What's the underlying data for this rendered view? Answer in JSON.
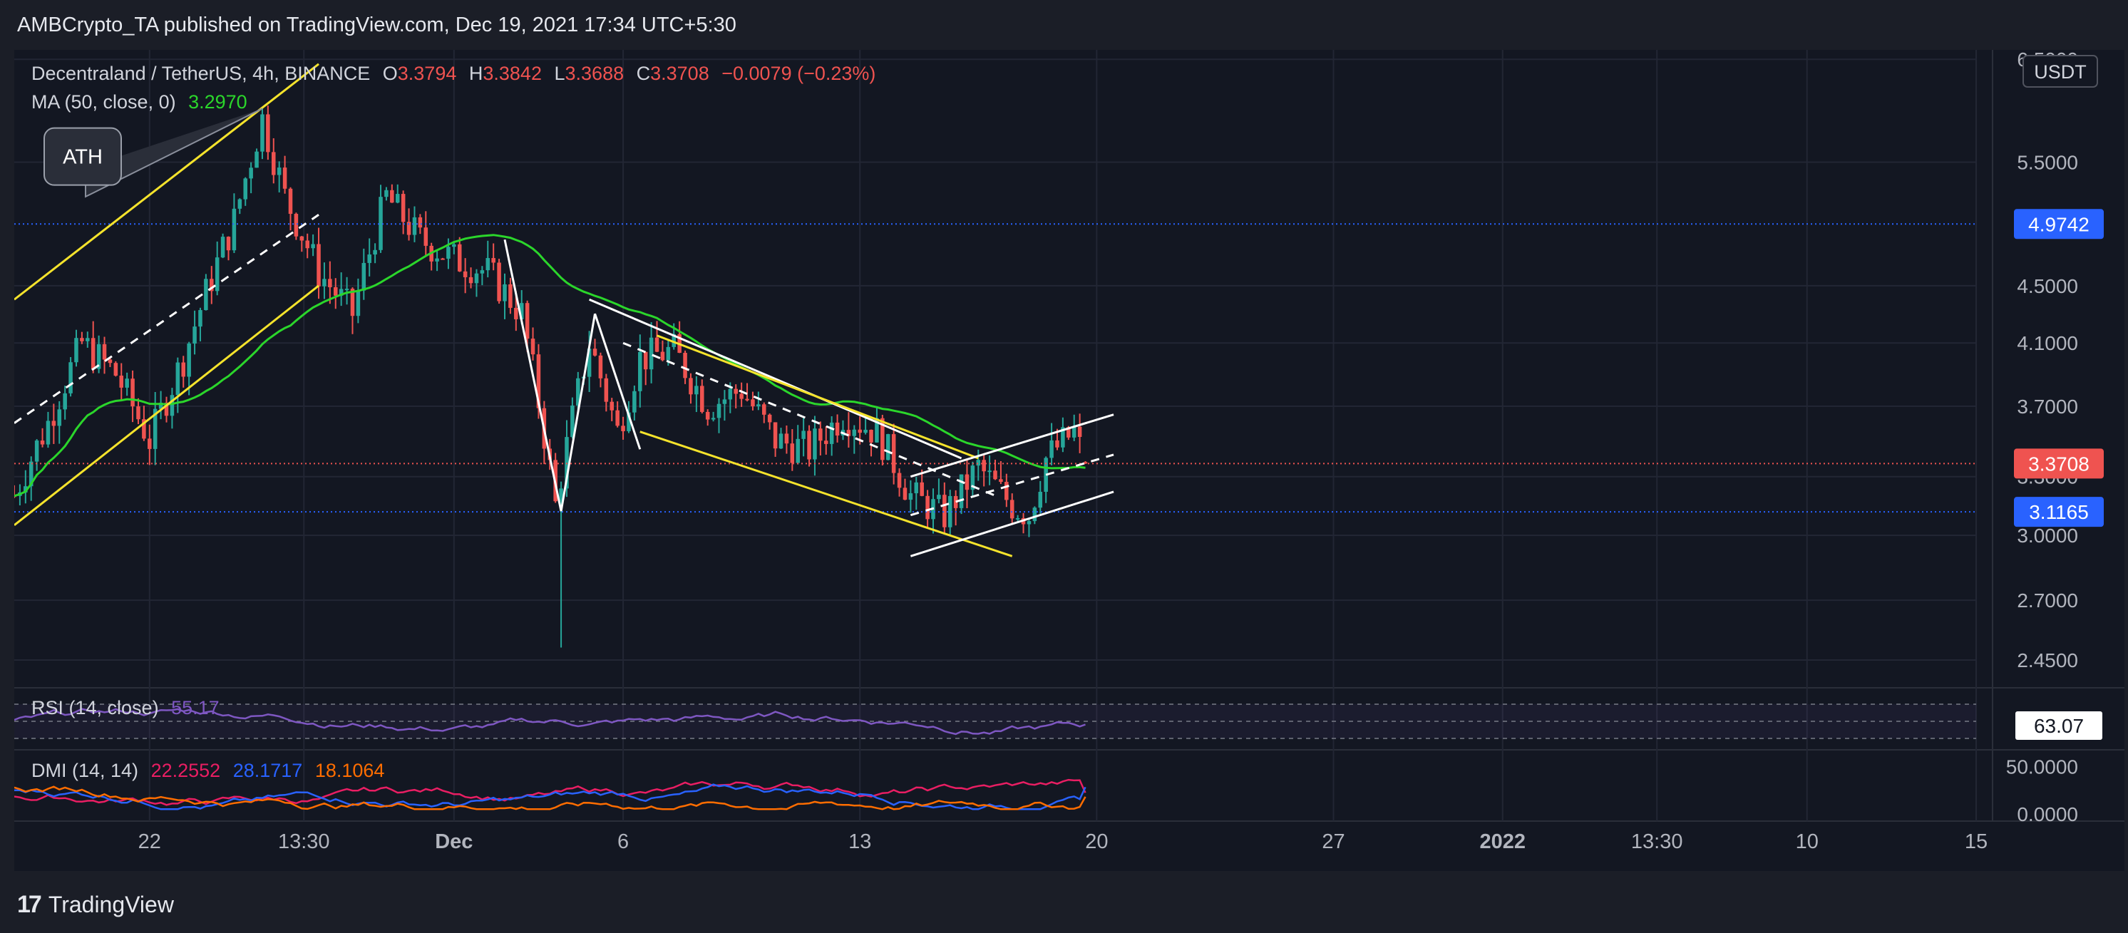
{
  "header": {
    "publisher_line": "AMBCrypto_TA published on TradingView.com, Dec 19, 2021 17:34 UTC+5:30"
  },
  "footer": {
    "brand": "TradingView",
    "logo_glyph": "17"
  },
  "colors": {
    "bg": "#131722",
    "up": "#26a69a",
    "down": "#ef5350",
    "ma": "#2bd62b",
    "trend_yellow": "#f5e32c",
    "trend_white": "#ffffff",
    "rsi": "#7e57c2",
    "dmi_plus": "#e91e63",
    "dmi_minus": "#2962ff",
    "adx": "#ff6d00",
    "blue_level": "#2962ff",
    "red_level": "#ef5350"
  },
  "legend": {
    "symbol": "Decentraland / TetherUS, 4h, BINANCE",
    "o_label": "O",
    "o": "3.3794",
    "h_label": "H",
    "h": "3.3842",
    "l_label": "L",
    "l": "3.3688",
    "c_label": "C",
    "c": "3.3708",
    "change": "−0.0079 (−0.23%)",
    "ma_label": "MA (50, close, 0)",
    "ma_value": "3.2970",
    "rsi_label": "RSI (14, close)",
    "rsi_value": "55.17",
    "dmi_label": "DMI (14, 14)",
    "dmi_plus": "22.2552",
    "dmi_minus": "28.1717",
    "adx": "18.1064"
  },
  "annotations": {
    "ath": "ATH"
  },
  "chart_data": [
    {
      "type": "candlestick",
      "title": "Decentraland / TetherUS, 4h, BINANCE",
      "price_scale": {
        "unit": "USDT",
        "ticks": [
          "6.5000",
          "5.5000",
          "4.5000",
          "4.1000",
          "3.7000",
          "3.3000",
          "3.0000",
          "2.7000",
          "2.4500"
        ],
        "scale": "log",
        "ylim": [
          2.35,
          6.6
        ]
      },
      "time_axis": {
        "ticks": [
          "22",
          "13:30",
          "Dec",
          "6",
          "13",
          "20",
          "27",
          "2022",
          "13:30",
          "10",
          "15"
        ],
        "range": [
          "2021-11-18",
          "2022-01-15"
        ]
      },
      "price_labels": [
        {
          "value": 4.9742,
          "text": "4.9742",
          "kind": "horizontal-line",
          "color": "#2962ff"
        },
        {
          "value": 3.3708,
          "text": "3.3708",
          "kind": "last-price",
          "color": "#ef5350"
        },
        {
          "value": 3.1165,
          "text": "3.1165",
          "kind": "horizontal-line",
          "color": "#2962ff"
        }
      ],
      "path_points": [
        [
          "2021-11-18 00:00",
          3.2
        ],
        [
          "2021-11-19 00:00",
          3.6
        ],
        [
          "2021-11-20 00:00",
          4.1
        ],
        [
          "2021-11-21 00:00",
          3.9
        ],
        [
          "2021-11-22 00:00",
          3.5
        ],
        [
          "2021-11-23 00:00",
          4.0
        ],
        [
          "2021-11-24 12:00",
          5.0
        ],
        [
          "2021-11-25 08:00",
          5.9
        ],
        [
          "2021-11-26 00:00",
          5.2
        ],
        [
          "2021-11-27 00:00",
          4.6
        ],
        [
          "2021-11-28 00:00",
          4.3
        ],
        [
          "2021-11-29 00:00",
          5.2
        ],
        [
          "2021-11-30 00:00",
          4.85
        ],
        [
          "2021-12-01 00:00",
          4.7
        ],
        [
          "2021-12-02 00:00",
          4.6
        ],
        [
          "2021-12-03 00:00",
          4.3
        ],
        [
          "2021-12-04 00:00",
          3.15
        ],
        [
          "2021-12-05 00:00",
          4.1
        ],
        [
          "2021-12-05 20:00",
          3.55
        ],
        [
          "2021-12-06 12:00",
          4.0
        ],
        [
          "2021-12-07 12:00",
          4.05
        ],
        [
          "2021-12-08 12:00",
          3.7
        ],
        [
          "2021-12-09 12:00",
          3.8
        ],
        [
          "2021-12-10 12:00",
          3.5
        ],
        [
          "2021-12-11 12:00",
          3.45
        ],
        [
          "2021-12-12 12:00",
          3.65
        ],
        [
          "2021-12-13 12:00",
          3.55
        ],
        [
          "2021-12-14 12:00",
          3.2
        ],
        [
          "2021-12-15 12:00",
          3.1
        ],
        [
          "2021-12-16 12:00",
          3.35
        ],
        [
          "2021-12-17 12:00",
          3.15
        ],
        [
          "2021-12-18 00:00",
          3.1
        ],
        [
          "2021-12-18 12:00",
          3.4
        ],
        [
          "2021-12-19 08:00",
          3.55
        ],
        [
          "2021-12-19 16:00",
          3.37
        ]
      ],
      "notable_wicks": [
        {
          "time": "2021-11-25 08:00",
          "high": 6.0,
          "note": "ATH"
        },
        {
          "time": "2021-12-04 04:00",
          "low": 2.5
        }
      ]
    },
    {
      "type": "line",
      "title": "RSI (14, close)",
      "last_value": 63.07,
      "last_value_text": "63.07"
    },
    {
      "type": "line",
      "title": "DMI (14, 14)",
      "ticks": [
        "50.0000",
        "0.0000"
      ],
      "series": [
        {
          "name": "+DI",
          "last": 22.2552
        },
        {
          "name": "−DI",
          "last": 28.1717
        },
        {
          "name": "ADX",
          "last": 18.1064
        }
      ]
    }
  ]
}
